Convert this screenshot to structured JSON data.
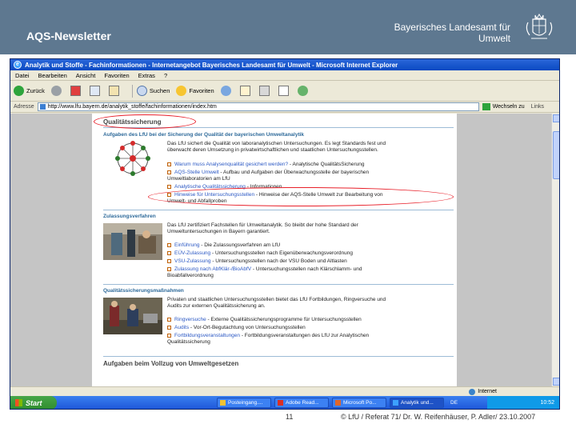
{
  "slide": {
    "title": "AQS-Newsletter",
    "org_line1": "Bayerisches Landesamt für",
    "org_line2": "Umwelt",
    "number": "11",
    "footer": "© LfU / Referat 71/ Dr. W. Reifenhäuser, P. Adler/ 23.10.2007"
  },
  "browser": {
    "window_title": "Analytik und Stoffe - Fachinformationen - Internetangebot Bayerisches Landesamt für Umwelt - Microsoft Internet Explorer",
    "menu": [
      "Datei",
      "Bearbeiten",
      "Ansicht",
      "Favoriten",
      "Extras",
      "?"
    ],
    "toolbar": {
      "back": "Zurück",
      "search": "Suchen",
      "favorites": "Favoriten"
    },
    "address_label": "Adresse",
    "address_value": "http://www.lfu.bayern.de/analytik_stoffe/fachinformationen/index.htm",
    "goto_label": "Wechseln zu",
    "links_label": "Links",
    "status_zone": "Internet"
  },
  "page": {
    "heading": "Qualitätssicherung",
    "sec1": {
      "title": "Aufgaben des LfU bei der Sicherung der Qualität der bayerischen Umweltanalytik",
      "text_lines": [
        "Das LfU sichert die Qualität von laboranalytischen Untersuchungen. Es legt Standards fest und",
        "überwacht deren Umsetzung in privatwirtschaftlichen und staatlichen Untersuchungsstellen."
      ],
      "links": [
        {
          "link": "Warum muss Analysenqualität gesichert werden?",
          "desc": " - Analytische QualitätsSicherung"
        },
        {
          "link": "AQS-Stelle Umwelt",
          "desc": " - Aufbau und Aufgaben der Überwachungsstelle der bayerischen",
          "desc2": "Umweltlaboratorien am LfU"
        },
        {
          "link": "Analytische Qualitätssicherung",
          "desc": " - Informationen"
        },
        {
          "link": "Hinweise für Untersuchungsstellen",
          "desc": " - Hinweise der AQS-Stelle Umwelt zur Bearbeitung von",
          "desc2": "Umwelt- und Abfallproben"
        }
      ]
    },
    "sec2": {
      "title": "Zulassungsverfahren",
      "text_lines": [
        "Das LfU zertifiziert Fachstellen für Umweltanalytik. So bleibt der hohe Standard der",
        "Umweltuntersuchungen in Bayern garantiert."
      ],
      "links": [
        {
          "link": "Einführung",
          "desc": " - Die Zulassungsverfahren am LfU"
        },
        {
          "link": "EÜV-Zulassung",
          "desc": " - Untersuchungsstellen nach Eigenüberwachungsverordnung"
        },
        {
          "link": "VSU-Zulassung",
          "desc": " - Untersuchungsstellen nach der VSU Boden und Altlasten"
        },
        {
          "link": "Zulassung nach AbfKlär-/BioAbfV",
          "desc": " - Untersuchungsstellen nach Klärschlamm- und",
          "desc2": "Bioabfallverordnung"
        }
      ]
    },
    "sec3": {
      "title": "Qualitätssicherungsmaßnahmen",
      "text_lines": [
        "Privaten und staatlichen Untersuchungsstellen bietet das LfU Fortbildungen, Ringversuche und",
        "Audits zur externen Qualitätssicherung an."
      ],
      "links": [
        {
          "link": "Ringversuche",
          "desc": " - Externe Qualitätssicherungsprogramme für Untersuchungsstellen"
        },
        {
          "link": "Audits",
          "desc": " - Vor-Ort-Begutachtung von Untersuchungsstellen"
        },
        {
          "link": "Fortbildungsveranstaltungen",
          "desc": " - Fortbildungsveranstaltungen des LfU zur Analytischen",
          "desc2": "Qualitätssicherung"
        }
      ]
    },
    "sec4_heading": "Aufgaben beim Vollzug von Umweltgesetzen"
  },
  "taskbar": {
    "start": "Start",
    "tasks": [
      "Posteingang....",
      "Adobe Read...",
      "Microsoft Po...",
      "Analytik und..."
    ],
    "lang": "DE",
    "clock": "10:52"
  },
  "colors": {
    "header_bg": "#5e7890",
    "annotation": "#e8202a",
    "link": "#2b58c4",
    "section_title": "#2e6a9a"
  }
}
